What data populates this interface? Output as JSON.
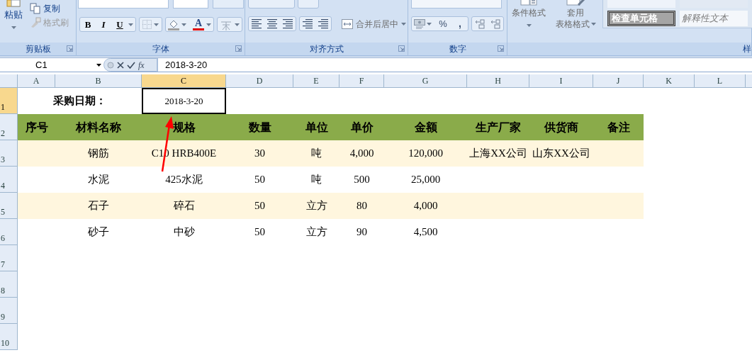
{
  "ribbon": {
    "groups": [
      {
        "kind": "clipboard",
        "label": "剪贴板",
        "paste": "粘贴",
        "copy": {
          "label": "复制",
          "disabled": false
        },
        "format_painter": {
          "label": "格式刷",
          "disabled": true
        }
      },
      {
        "kind": "font",
        "label": "字体",
        "bold": "B",
        "italic": "I",
        "underline": "U",
        "font_color": "A"
      },
      {
        "kind": "alignment",
        "label": "对齐方式",
        "merge": "合并后居中"
      },
      {
        "kind": "number",
        "label": "数字",
        "percent": "%",
        "comma": ","
      },
      {
        "kind": "styles",
        "label": "样",
        "conditional": "条件格式",
        "table_format": [
          "套用",
          "表格格式"
        ],
        "cell_styles": [
          {
            "label": "检查单元格",
            "kind": "check"
          },
          {
            "label": "解释性文本",
            "kind": "explanatory"
          }
        ]
      }
    ]
  },
  "formula_bar": {
    "name_box": "C1",
    "fx": "fx",
    "formula": "2018-3-20"
  },
  "sheet": {
    "columns": [
      {
        "label": "A",
        "selected": false
      },
      {
        "label": "B",
        "selected": false
      },
      {
        "label": "C",
        "selected": true
      },
      {
        "label": "D",
        "selected": false
      },
      {
        "label": "E",
        "selected": false
      },
      {
        "label": "F",
        "selected": false
      },
      {
        "label": "G",
        "selected": false
      },
      {
        "label": "H",
        "selected": false
      },
      {
        "label": "I",
        "selected": false
      },
      {
        "label": "J",
        "selected": false
      },
      {
        "label": "K",
        "selected": false
      },
      {
        "label": "L",
        "selected": false
      }
    ],
    "row_numbers": [
      {
        "label": "1",
        "selected": true
      },
      {
        "label": "2",
        "selected": false
      },
      {
        "label": "3",
        "selected": false
      },
      {
        "label": "4",
        "selected": false
      },
      {
        "label": "5",
        "selected": false
      },
      {
        "label": "6",
        "selected": false
      },
      {
        "label": "7",
        "selected": false
      },
      {
        "label": "8",
        "selected": false
      },
      {
        "label": "9",
        "selected": false
      },
      {
        "label": "10",
        "selected": false
      }
    ],
    "date_label": "采购日期：",
    "date_value": "2018-3-20",
    "headers": [
      "序号",
      "材料名称",
      "规格",
      "数量",
      "单位",
      "单价",
      "金额",
      "生产厂家",
      "供货商",
      "备注"
    ],
    "rows": [
      {
        "shaded": true,
        "material": "钢筋",
        "spec": "C10 HRB400E",
        "qty": "30",
        "unit": "吨",
        "price": "4,000",
        "amount": "120,000",
        "maker": "上海XX公司",
        "supplier": "山东XX公司"
      },
      {
        "shaded": false,
        "material": "水泥",
        "spec": "425水泥",
        "qty": "50",
        "unit": "吨",
        "price": "500",
        "amount": "25,000"
      },
      {
        "shaded": true,
        "material": "石子",
        "spec": "碎石",
        "qty": "50",
        "unit": "立方",
        "price": "80",
        "amount": "4,000"
      },
      {
        "shaded": false,
        "material": "砂子",
        "spec": "中砂",
        "qty": "50",
        "unit": "立方",
        "price": "90",
        "amount": "4,500"
      }
    ]
  }
}
